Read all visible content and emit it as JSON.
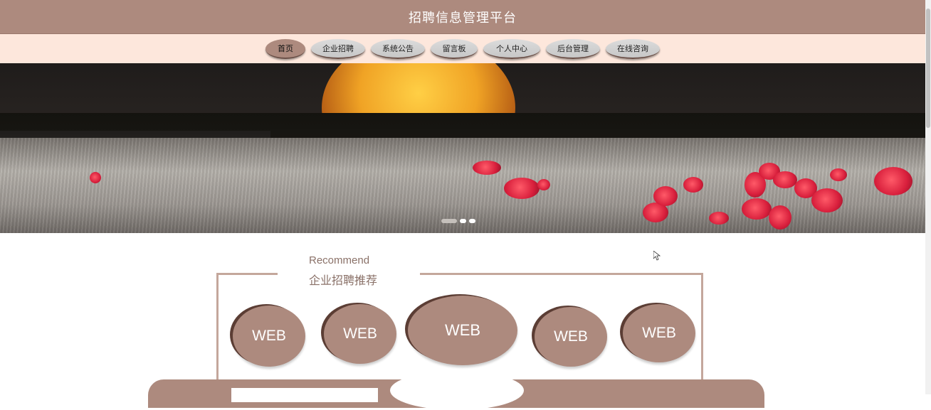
{
  "header": {
    "title": "招聘信息管理平台"
  },
  "nav": {
    "items": [
      {
        "label": "首页",
        "active": true
      },
      {
        "label": "企业招聘"
      },
      {
        "label": "系统公告"
      },
      {
        "label": "留言板"
      },
      {
        "label": "个人中心"
      },
      {
        "label": "后台管理"
      },
      {
        "label": "在线咨询"
      }
    ]
  },
  "carousel": {
    "slide_count": 3,
    "active_index": 0
  },
  "recommend": {
    "label_en": "Recommend",
    "title": "企业招聘推荐",
    "badges": [
      "WEB",
      "WEB",
      "WEB",
      "WEB",
      "WEB"
    ]
  },
  "colors": {
    "brand": "#ad8a7e",
    "nav_bg": "#fde7dc",
    "badge_shadow": "#5b3d34"
  }
}
